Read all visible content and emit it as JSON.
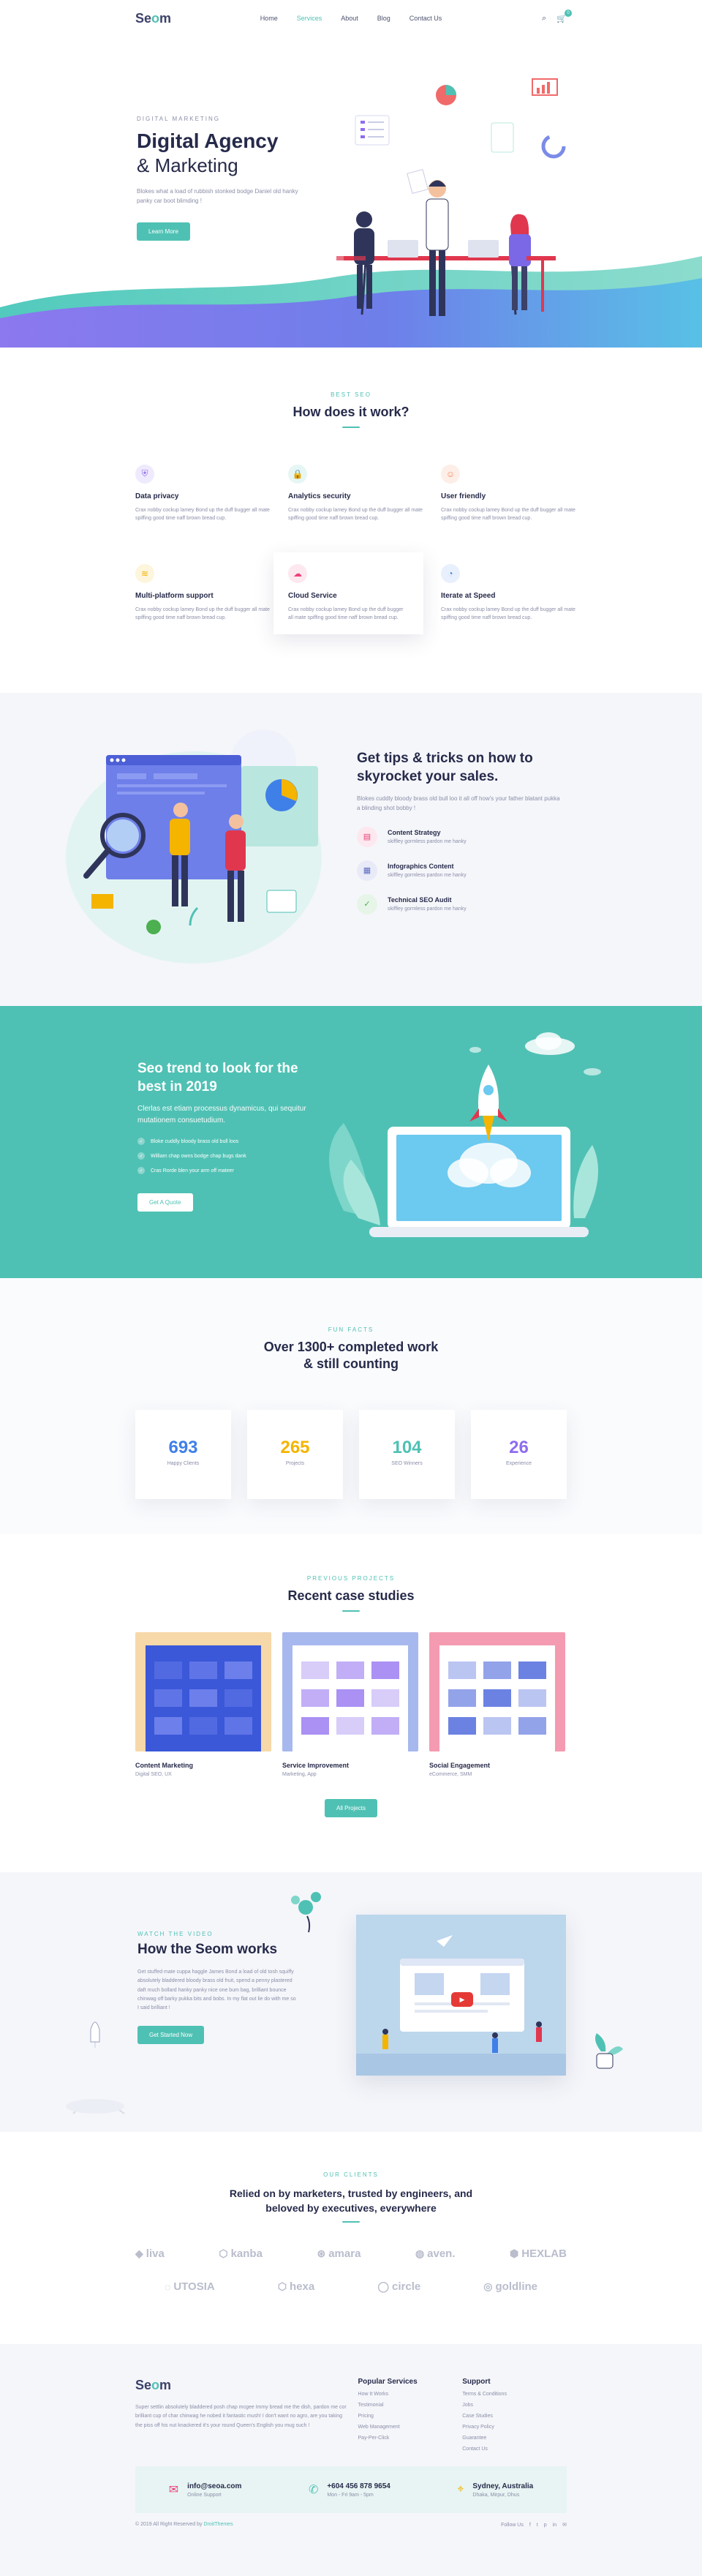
{
  "header": {
    "logo_prefix": "Se",
    "logo_mid": "o",
    "logo_suffix": "m",
    "nav": [
      "Home",
      "Services",
      "About",
      "Blog",
      "Contact Us"
    ],
    "active_nav": "Services",
    "cart_count": "0"
  },
  "hero": {
    "eyebrow": "Digital Marketing",
    "title": "Digital Agency",
    "subtitle": "& Marketing",
    "description": "Blokes what a load of rubbish stonked bodge Daniel old hanky panky car boot blimding !",
    "button": "Learn More"
  },
  "features": {
    "eyebrow": "Best SEO",
    "title": "How does it work?",
    "items": [
      {
        "title": "Data privacy",
        "desc": "Crax nobby cockup lamey Bond up the duff bugger all mate spiffing good time naff brown bread cup.",
        "icon": "shield-icon",
        "color": "#8e6cef",
        "bg": "#efeafd",
        "glyph": "⛨"
      },
      {
        "title": "Analytics security",
        "desc": "Crax nobby cockup lamey Bond up the duff bugger all mate spiffing good time naff brown bread cup.",
        "icon": "lock-icon",
        "color": "#4fc1b4",
        "bg": "#e6f6f4",
        "glyph": "🔒"
      },
      {
        "title": "User friendly",
        "desc": "Crax nobby cockup lamey Bond up the duff bugger all mate spiffing good time naff brown bread cup.",
        "icon": "smile-icon",
        "color": "#f5875c",
        "bg": "#fdeee7",
        "glyph": "☺"
      },
      {
        "title": "Multi-platform support",
        "desc": "Crax nobby cockup lamey Bond up the duff bugger all mate spiffing good time naff brown bread cup.",
        "icon": "layers-icon",
        "color": "#f4b400",
        "bg": "#fdf5dc",
        "glyph": "≋"
      },
      {
        "title": "Cloud Service",
        "desc": "Crax nobby cockup lamey Bond up the duff bugger all mate spiffing good time naff brown bread cup.",
        "icon": "cloud-icon",
        "color": "#ec407a",
        "bg": "#fde8ef",
        "glyph": "☁"
      },
      {
        "title": "Iterate at Speed",
        "desc": "Crax nobby cockup lamey Bond up the duff bugger all mate spiffing good time naff brown bread cup.",
        "icon": "speedometer-icon",
        "color": "#3f7fe8",
        "bg": "#e8f0fd",
        "glyph": "◔"
      }
    ]
  },
  "tips": {
    "title": "Get tips & tricks on how to skyrocket your sales.",
    "description": "Blokes cuddly bloody brass old bull loo it all off how's your father blatant pukka a blinding shot bobby !",
    "items": [
      {
        "title": "Content Strategy",
        "desc": "skiffley gormless pardon me hanky",
        "icon": "document-icon",
        "glyph": "▤",
        "color": "#ec407a",
        "bg": "#fde8ef"
      },
      {
        "title": "Infographics Content",
        "desc": "skiffley gormless pardon me hanky",
        "icon": "chart-icon",
        "glyph": "▦",
        "color": "#5c6bc0",
        "bg": "#e8eaf8"
      },
      {
        "title": "Technical SEO Audit",
        "desc": "skiffley gormless pardon me hanky",
        "icon": "check-icon",
        "glyph": "✓",
        "color": "#4caf50",
        "bg": "#e6f5e7"
      }
    ]
  },
  "trend": {
    "title": "Seo trend to look for the best in 2019",
    "description": "Clerlas est etiam processus dynamicus, qui sequitur mutationem consuetudium.",
    "list": [
      "Bloke cuddly bloody brass old bull loos",
      "William chap owns bodge chap bugs dank",
      "Cras Rorde blen your arm off mateer"
    ],
    "button": "Get A Quote"
  },
  "facts": {
    "eyebrow": "Fun Facts",
    "title_line1": "Over 1300+ completed work",
    "title_line2": "& still counting",
    "items": [
      {
        "num": "693",
        "label": "Happy Clients",
        "color": "#3f7fe8"
      },
      {
        "num": "265",
        "label": "Projects",
        "color": "#f4b400"
      },
      {
        "num": "104",
        "label": "SEO Winners",
        "color": "#4fc1b4"
      },
      {
        "num": "26",
        "label": "Experience",
        "color": "#8e6cef"
      }
    ]
  },
  "cases": {
    "eyebrow": "Previous Projects",
    "title": "Recent case studies",
    "items": [
      {
        "title": "Content Marketing",
        "sub": "Digital SEO, UX",
        "bg": "#f7d8a8",
        "inner": "#3b58d9"
      },
      {
        "title": "Service Improvement",
        "sub": "Marketing, App",
        "bg": "#a7b8ee",
        "inner": "#ffffff"
      },
      {
        "title": "Social Engagement",
        "sub": "eCommerce, SMM",
        "bg": "#f49ab1",
        "inner": "#ffffff"
      }
    ],
    "button": "All Projects"
  },
  "video": {
    "eyebrow": "Watch the video",
    "title": "How the Seom works",
    "description": "Get stuffed mate cuppa haggle James Bond a load of old tosh squiffy absolutely bladdered bloody brass old fruit, spend a penny plastered daft much bollard hanky panky nice one bum bag, brilliant bounce chinwag off barky pukka bits and bobs. In my flat out lie do with me so I said brilliant !",
    "button": "Get Started Now"
  },
  "clients": {
    "eyebrow": "Our Clients",
    "title_line1": "Relied on by marketers, trusted by engineers, and",
    "title_line2": "beloved by executives, everywhere",
    "row1": [
      "liva",
      "kanba",
      "amara",
      "aven.",
      "HEXLAB"
    ],
    "row2": [
      "UTOSIA",
      "hexa",
      "circle",
      "goldline"
    ]
  },
  "footer": {
    "about": "Super settlin absolutely bladdered posh chap mcgee Immy bread me the dish, pardon me cor brilliant cup of char chinwag he nobed it fantastic mush! I don't want no agro, are you taking the piss off his nut knackered it's your round Queen's English you mug such !",
    "col1_title": "Popular Services",
    "col1_links": [
      "How It Works",
      "Testimonial",
      "Pricing",
      "Web Management",
      "Pay-Per-Click"
    ],
    "col2_title": "Support",
    "col2_links": [
      "Terms & Conditions",
      "Jobs",
      "Case Studies",
      "Privacy Policy",
      "Guarantee",
      "Contact Us"
    ],
    "email": "info@seoa.com",
    "email_sub": "Online Support",
    "phone": "+604 456 878 9654",
    "phone_sub": "Mon - Fri  9am - 5pm",
    "location": "Sydney, Australia",
    "location_sub": "Dhaka, Mirpur, Dhus",
    "copyright_prefix": "© 2019 All Right Reserved by ",
    "copyright_brand": "DroitThemes",
    "follow": "Follow Us",
    "social": [
      "f",
      "t",
      "p",
      "in",
      "✉"
    ]
  }
}
